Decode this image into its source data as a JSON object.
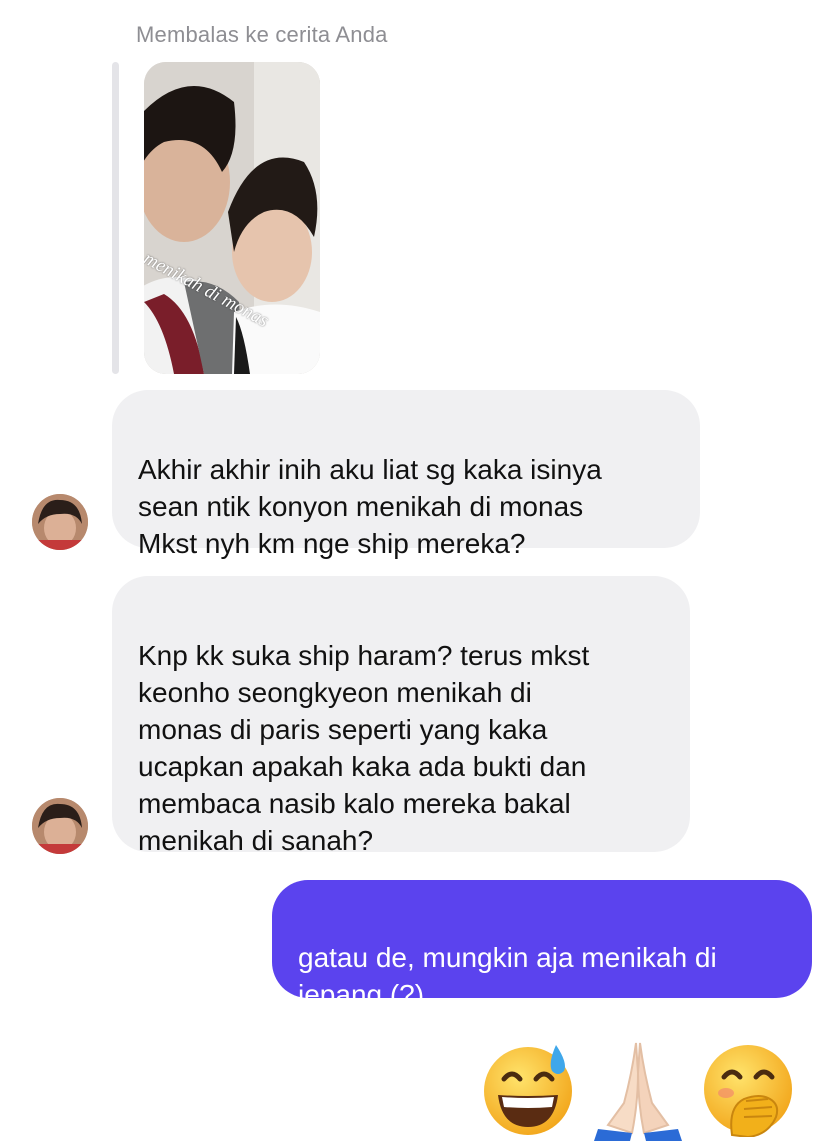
{
  "reply": {
    "label": "Membalas ke cerita Anda",
    "story_caption": "menikah di monas"
  },
  "messages": [
    {
      "direction": "in",
      "text": "Akhir akhir inih aku liat sg kaka isinya\nsean ntik konyon menikah di monas\nMkst nyh km nge ship mereka?"
    },
    {
      "direction": "in",
      "text": "Knp kk suka ship haram? terus mkst\nkeonho seongkyeon menikah di\nmonas di paris seperti yang kaka\nucapkan apakah kaka ada bukti dan\nmembaca nasib kalo mereka bakal\nmenikah di sanah?"
    },
    {
      "direction": "out",
      "text": "gatau de, mungkin aja menikah di\njepang (?)"
    }
  ],
  "reactions": [
    {
      "icon": "grinning-sweat-emoji"
    },
    {
      "icon": "folded-hands-emoji"
    },
    {
      "icon": "hand-over-mouth-emoji"
    }
  ],
  "colors": {
    "incoming_bubble": "#f0f0f2",
    "outgoing_bubble": "#5b43ee",
    "secondary_text": "#8e8e93"
  }
}
